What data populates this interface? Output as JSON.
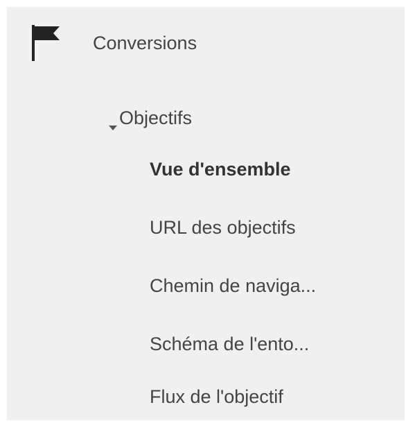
{
  "nav": {
    "section": {
      "label": "Conversions",
      "icon": "flag-icon"
    },
    "group": {
      "label": "Objectifs",
      "icon": "caret-down-icon",
      "expanded": true
    },
    "items": [
      {
        "label": "Vue d'ensemble",
        "active": true
      },
      {
        "label": "URL des objectifs",
        "active": false
      },
      {
        "label": "Chemin de naviga...",
        "active": false
      },
      {
        "label": "Schéma de l'ento...",
        "active": false
      },
      {
        "label": "Flux de l'objectif",
        "active": false
      }
    ]
  },
  "colors": {
    "panel_background": "#f0f0f0",
    "text": "#444444",
    "active_text": "#333333",
    "icon": "#222222"
  }
}
